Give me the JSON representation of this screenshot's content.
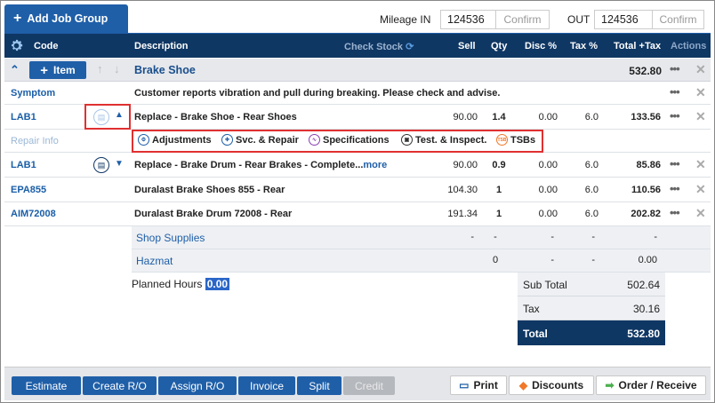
{
  "toolbar": {
    "add_job_group": "Add Job Group",
    "mileage_in_label": "Mileage IN",
    "mileage_in_value": "124536",
    "confirm_label": "Confirm",
    "out_label": "OUT",
    "mileage_out_value": "124536",
    "confirm_out_label": "Confirm"
  },
  "header": {
    "code": "Code",
    "description": "Description",
    "check_stock": "Check Stock",
    "sell": "Sell",
    "qty": "Qty",
    "disc": "Disc %",
    "tax": "Tax %",
    "total": "Total +Tax",
    "actions": "Actions"
  },
  "job": {
    "item_button": "Item",
    "title": "Brake Shoe",
    "total": "532.80"
  },
  "symptom": {
    "code": "Symptom",
    "text": "Customer reports vibration and pull during breaking. Please check and advise."
  },
  "lines": [
    {
      "code": "LAB1",
      "desc": "Replace - Brake Shoe - Rear Shoes",
      "sell": "90.00",
      "qty": "1.4",
      "disc": "0.00",
      "tax": "6.0",
      "total": "133.56"
    },
    {
      "code": "LAB1",
      "desc": "Replace - Brake Drum - Rear Brakes - Complete...",
      "more": "more",
      "sell": "90.00",
      "qty": "0.9",
      "disc": "0.00",
      "tax": "6.0",
      "total": "85.86"
    },
    {
      "code": "EPA855",
      "desc": "Duralast Brake Shoes 855 - Rear",
      "sell": "104.30",
      "qty": "1",
      "disc": "0.00",
      "tax": "6.0",
      "total": "110.56"
    },
    {
      "code": "AIM72008",
      "desc": "Duralast Brake Drum 72008 - Rear",
      "sell": "191.34",
      "qty": "1",
      "disc": "0.00",
      "tax": "6.0",
      "total": "202.82"
    }
  ],
  "repair_info": {
    "label": "Repair Info",
    "tabs": [
      "Adjustments",
      "Svc. & Repair",
      "Specifications",
      "Test. & Inspect.",
      "TSBs"
    ],
    "tsb_badge": "TSB"
  },
  "shop_supplies": {
    "label": "Shop Supplies",
    "sell": "-",
    "qty": "-",
    "disc": "-",
    "tax": "-",
    "total": "-"
  },
  "hazmat": {
    "label": "Hazmat",
    "qty": "0",
    "disc": "-",
    "tax": "-",
    "total": "0.00"
  },
  "planned": {
    "label": "Planned Hours",
    "value": "0.00"
  },
  "totals": {
    "subtotal_label": "Sub Total",
    "subtotal": "502.64",
    "tax_label": "Tax",
    "tax": "30.16",
    "total_label": "Total",
    "total": "532.80"
  },
  "footer": {
    "estimate": "Estimate",
    "create_ro": "Create R/O",
    "assign_ro": "Assign R/O",
    "invoice": "Invoice",
    "split": "Split",
    "credit": "Credit",
    "print": "Print",
    "discounts": "Discounts",
    "order_receive": "Order / Receive"
  },
  "colors": {
    "primary": "#1f5fa8",
    "header": "#0f3764",
    "highlight": "#e03030"
  }
}
